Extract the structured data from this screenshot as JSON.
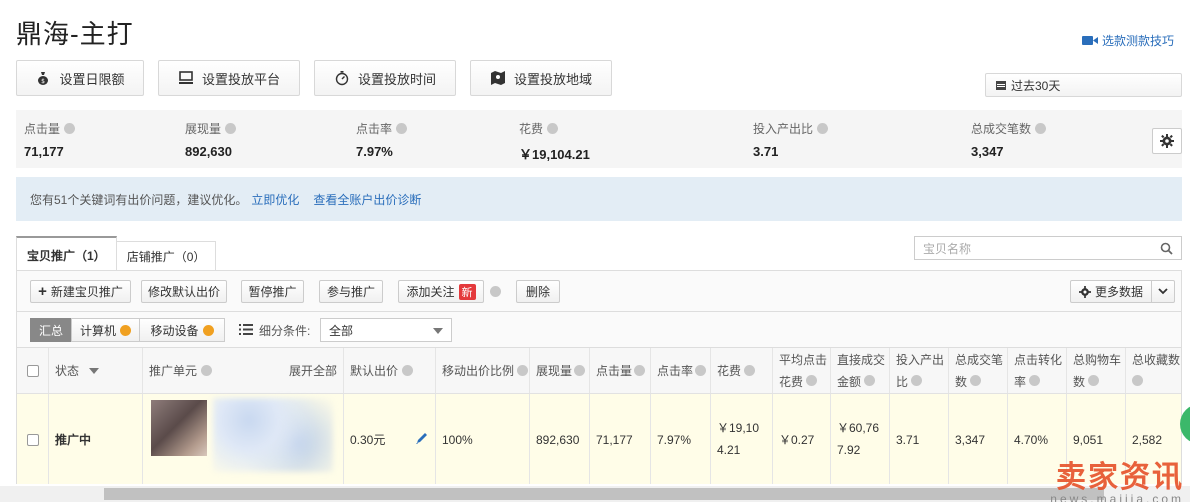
{
  "page": {
    "title": "鼎海-主打"
  },
  "tip_link": {
    "label": "选款测款技巧"
  },
  "setting_buttons": [
    {
      "label": "设置日限额",
      "icon": "money-bag-icon"
    },
    {
      "label": "设置投放平台",
      "icon": "monitor-icon"
    },
    {
      "label": "设置投放时间",
      "icon": "stopwatch-icon"
    },
    {
      "label": "设置投放地域",
      "icon": "map-icon"
    }
  ],
  "date_range": {
    "label": "过去30天"
  },
  "stats": [
    {
      "label": "点击量",
      "value": "71,177"
    },
    {
      "label": "展现量",
      "value": "892,630"
    },
    {
      "label": "点击率",
      "value": "7.97%"
    },
    {
      "label": "花费",
      "value": "￥19,104.21"
    },
    {
      "label": "投入产出比",
      "value": "3.71"
    },
    {
      "label": "总成交笔数",
      "value": "3,347"
    }
  ],
  "notice": {
    "text": "您有51个关键词有出价问题，建议优化。",
    "link1": "立即优化",
    "link2": "查看全账户出价诊断"
  },
  "tabs": [
    {
      "label": "宝贝推广（1）"
    },
    {
      "label": "店铺推广（0）"
    }
  ],
  "search": {
    "placeholder": "宝贝名称"
  },
  "toolbar": {
    "new_item": "新建宝贝推广",
    "modify_bid": "修改默认出价",
    "pause": "暂停推广",
    "join": "参与推广",
    "follow": "添加关注",
    "new_badge": "新",
    "delete": "删除",
    "more_data": "更多数据"
  },
  "filters": {
    "summary": "汇总",
    "computer": "计算机",
    "mobile": "移动设备",
    "segment_label": "细分条件:",
    "segment_value": "全部"
  },
  "table": {
    "headers": {
      "status": "状态",
      "unit": "推广单元",
      "expand_all": "展开全部",
      "default_bid": "默认出价",
      "mobile_ratio": "移动出价比例",
      "impressions": "展现量",
      "clicks": "点击量",
      "ctr": "点击率",
      "cost": "花费",
      "avg_cpc_1": "平均点击",
      "avg_cpc_2": "花费",
      "direct_gmv_1": "直接成交",
      "direct_gmv_2": "金额",
      "roi_1": "投入产出",
      "roi_2": "比",
      "orders_1": "总成交笔",
      "orders_2": "数",
      "cvr_1": "点击转化",
      "cvr_2": "率",
      "cart_1": "总购物车",
      "cart_2": "数",
      "fav_1": "总收藏数"
    },
    "row": {
      "status": "推广中",
      "default_bid": "0.30元",
      "mobile_ratio": "100%",
      "impressions": "892,630",
      "clicks": "71,177",
      "ctr": "7.97%",
      "cost_1": "￥19,10",
      "cost_2": "4.21",
      "avg_cpc": "￥0.27",
      "direct_gmv_1": "￥60,76",
      "direct_gmv_2": "7.92",
      "roi": "3.71",
      "orders": "3,347",
      "cvr": "4.70%",
      "cart": "9,051",
      "fav": "2,582"
    }
  },
  "watermark": {
    "main": "卖家资讯",
    "sub": "news.maijia.com"
  }
}
